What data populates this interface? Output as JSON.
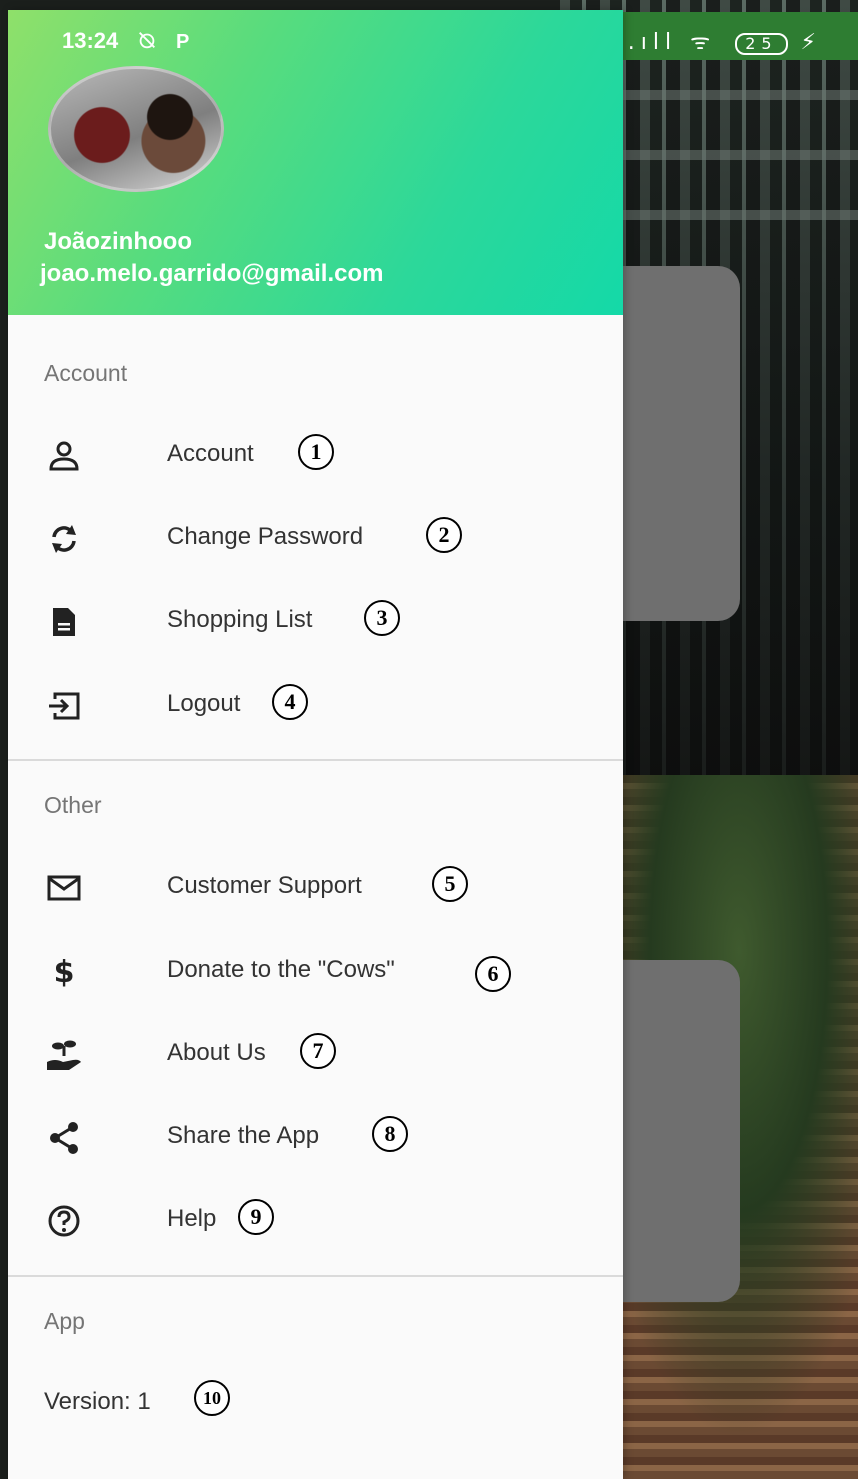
{
  "status_bar": {
    "time": "13:24",
    "alarm_off_icon": "alarm-off-icon",
    "parking_icon": "P",
    "signal_text": ".ıll",
    "wifi_text": "ᯤ",
    "battery_level": "25",
    "charging_icon": "⚡"
  },
  "profile": {
    "name": "Joãozinhooo",
    "email": "joao.melo.garrido@gmail.com"
  },
  "sections": {
    "account": "Account",
    "other": "Other",
    "app": "App"
  },
  "menu": {
    "account": [
      {
        "label": "Account",
        "icon": "person-icon",
        "badge": "1"
      },
      {
        "label": "Change Password",
        "icon": "sync-icon",
        "badge": "2"
      },
      {
        "label": "Shopping List",
        "icon": "document-icon",
        "badge": "3"
      },
      {
        "label": "Logout",
        "icon": "logout-icon",
        "badge": "4"
      }
    ],
    "other": [
      {
        "label": "Customer Support",
        "icon": "mail-icon",
        "badge": "5"
      },
      {
        "label": "Donate to the \"Cows\"",
        "icon": "dollar-icon",
        "badge": "6"
      },
      {
        "label": "About Us",
        "icon": "hand-plant-icon",
        "badge": "7"
      },
      {
        "label": "Share the App",
        "icon": "share-icon",
        "badge": "8"
      },
      {
        "label": "Help",
        "icon": "help-icon",
        "badge": "9"
      }
    ]
  },
  "app": {
    "version_label": "Version: 1",
    "badge": "10"
  },
  "colors": {
    "header_gradient_start": "#8fe06a",
    "header_gradient_end": "#14d9a8",
    "drawer_bg": "#fafafa",
    "section_text": "#757575",
    "item_text": "#333333"
  }
}
